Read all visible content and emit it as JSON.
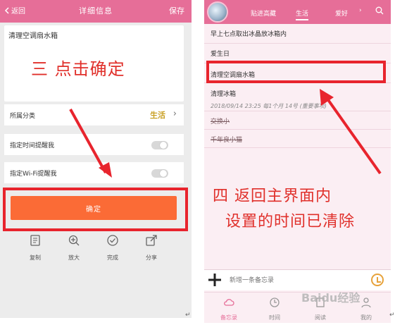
{
  "left": {
    "header": {
      "back": "返回",
      "title": "详细信息",
      "save": "保存"
    },
    "note_text": "清理空调扇水箱",
    "annotation": "三  点击确定",
    "category_row": {
      "label": "所属分类",
      "value": "生活"
    },
    "reminder_time_row": {
      "label": "指定时间提醒我"
    },
    "reminder_wifi_row": {
      "label": "指定Wi-Fi提醒我"
    },
    "confirm": "确定",
    "toolbar": [
      {
        "label": "复制",
        "icon": "document-icon"
      },
      {
        "label": "放大",
        "icon": "zoom-in-icon"
      },
      {
        "label": "完成",
        "icon": "check-circle-icon"
      },
      {
        "label": "分享",
        "icon": "share-icon"
      }
    ]
  },
  "right": {
    "tabs": {
      "fav": "贴进高藏",
      "life": "生活",
      "love": "爱好"
    },
    "list": [
      {
        "text": "早上七点取出冰晶放冰箱内"
      },
      {
        "text": "爱生日"
      },
      {
        "text": "清理空调扇水箱"
      },
      {
        "text": "清理冰箱",
        "meta": "2018/09/14 23:25  每1个月  14号  (重要事项)"
      },
      {
        "text": "交换小",
        "struck": true
      },
      {
        "text": "千年良小猫",
        "struck": true
      }
    ],
    "annotation_line1": "四  返回主界面内",
    "annotation_line2": "设置的时间已清除",
    "input_placeholder": "新增一条备忘录",
    "bottom_nav": [
      {
        "label": "备忘录",
        "icon": "cloud-icon"
      },
      {
        "label": "时间",
        "icon": "clock-icon"
      },
      {
        "label": "阅读",
        "icon": "book-icon"
      },
      {
        "label": "我的",
        "icon": "person-icon"
      }
    ]
  },
  "watermark": "Baidu经验",
  "colors": {
    "header_pink": "#e66e98",
    "confirm_orange": "#fb6b36",
    "annotation_red": "#e0302b",
    "category_gold": "#c9a024"
  }
}
